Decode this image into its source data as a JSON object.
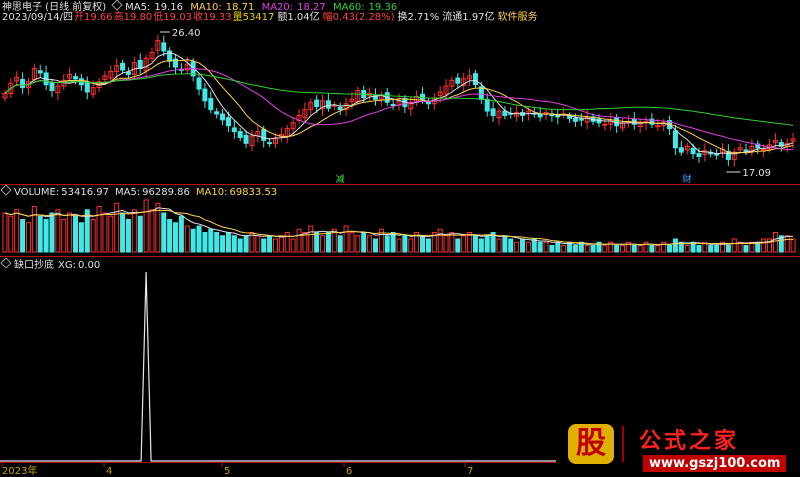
{
  "stock": {
    "title": "神思电子 (日线 前复权)",
    "date": "2023/09/14/四",
    "open_label": "开",
    "open": "19.66",
    "high_label": "高",
    "high": "19.80",
    "low_label": "低",
    "low": "19.03",
    "close_label": "收",
    "close": "19.33",
    "vol_label": "量",
    "volume": "53417",
    "amt_label": "额",
    "amount": "1.04亿",
    "chg_label": "幅",
    "change": "0.43(2.28%)",
    "turn_label": "换",
    "turnover": "2.71%",
    "float_label": "流通",
    "float_cap": "1.97亿",
    "sector": "软件服务"
  },
  "ma": [
    {
      "label": "MA5:",
      "value": "19.16",
      "color": "#e0e0e0"
    },
    {
      "label": "MA10:",
      "value": "18.71",
      "color": "#ffd24a"
    },
    {
      "label": "MA20:",
      "value": "18.27",
      "color": "#e040e0"
    },
    {
      "label": "MA60:",
      "value": "19.36",
      "color": "#30d030"
    }
  ],
  "vol_panel": {
    "label": "VOLUME:",
    "value": "53416.97",
    "ma5_label": "MA5:",
    "ma5": "96289.86",
    "ma10_label": "MA10:",
    "ma10": "69833.53"
  },
  "ind_panel": {
    "label": "缺口抄底",
    "xg_label": "XG:",
    "xg": "0.00"
  },
  "annotations": {
    "max_price": "26.40",
    "min_price": "17.09",
    "mark1": "减",
    "mark2": "财"
  },
  "xaxis": {
    "year": "2023年",
    "m4": "4",
    "m5": "5",
    "m6": "6",
    "m7": "7"
  },
  "colors": {
    "up": "#ff3030",
    "down": "#40e8e8",
    "axis": "#b01010"
  },
  "watermark": {
    "glyph": "股",
    "name": "公式之家",
    "url": "www.gszj100.com"
  },
  "chart_data": {
    "type": "candlestick",
    "price_range": [
      16.5,
      27.0
    ],
    "closes": [
      22.4,
      23.1,
      23.5,
      22.8,
      23.2,
      24.1,
      23.8,
      23.0,
      22.6,
      22.9,
      23.3,
      23.7,
      23.4,
      23.0,
      22.5,
      22.8,
      23.2,
      23.6,
      23.9,
      24.3,
      24.0,
      23.7,
      24.5,
      24.1,
      24.8,
      25.2,
      26.0,
      25.3,
      24.6,
      24.2,
      24.0,
      24.4,
      23.6,
      22.7,
      21.9,
      21.3,
      21.0,
      20.6,
      20.2,
      19.8,
      19.4,
      19.0,
      19.5,
      19.8,
      19.2,
      19.0,
      19.3,
      19.6,
      20.0,
      20.4,
      20.9,
      21.3,
      21.8,
      21.5,
      21.9,
      21.4,
      21.6,
      21.3,
      21.7,
      22.0,
      22.6,
      22.1,
      22.4,
      22.0,
      22.3,
      21.8,
      21.6,
      21.9,
      21.5,
      21.8,
      22.2,
      22.0,
      21.7,
      22.1,
      22.5,
      22.9,
      23.3,
      23.1,
      23.4,
      23.6,
      23.0,
      22.0,
      21.2,
      20.9,
      21.2,
      20.9,
      21.0,
      21.1,
      20.9,
      21.2,
      21.0,
      20.8,
      21.1,
      20.9,
      20.8,
      21.0,
      20.7,
      20.5,
      20.6,
      20.8,
      20.5,
      20.4,
      20.3,
      20.6,
      20.2,
      20.4,
      20.5,
      20.3,
      20.4,
      20.5,
      20.3,
      20.2,
      20.4,
      20.0,
      18.7,
      18.4,
      18.8,
      18.3,
      18.1,
      18.5,
      18.3,
      18.2,
      18.6,
      17.9,
      18.4,
      18.7,
      18.5,
      18.8,
      18.7,
      18.6,
      18.9,
      19.2,
      18.8,
      19.0,
      19.3
    ],
    "volumes": [
      1.2,
      1.1,
      1.3,
      1.0,
      0.9,
      1.4,
      1.1,
      1.0,
      1.2,
      1.3,
      1.0,
      1.2,
      1.1,
      0.9,
      1.3,
      1.0,
      1.4,
      1.2,
      1.1,
      1.5,
      1.2,
      1.0,
      1.3,
      1.1,
      1.6,
      1.3,
      1.5,
      1.2,
      1.0,
      0.9,
      1.1,
      0.8,
      0.7,
      0.8,
      0.6,
      0.7,
      0.6,
      0.5,
      0.6,
      0.5,
      0.4,
      0.5,
      0.6,
      0.5,
      0.4,
      0.5,
      0.4,
      0.5,
      0.6,
      0.4,
      0.7,
      0.6,
      0.8,
      0.6,
      0.5,
      0.6,
      0.7,
      0.5,
      0.8,
      0.6,
      0.5,
      0.6,
      0.5,
      0.4,
      0.7,
      0.5,
      0.6,
      0.4,
      0.5,
      0.4,
      0.6,
      0.5,
      0.4,
      0.6,
      0.7,
      0.5,
      0.6,
      0.4,
      0.5,
      0.6,
      0.5,
      0.4,
      0.5,
      0.6,
      0.4,
      0.5,
      0.4,
      0.3,
      0.4,
      0.3,
      0.4,
      0.3,
      0.3,
      0.2,
      0.3,
      0.2,
      0.3,
      0.2,
      0.3,
      0.2,
      0.2,
      0.3,
      0.2,
      0.3,
      0.2,
      0.2,
      0.3,
      0.2,
      0.2,
      0.3,
      0.2,
      0.2,
      0.3,
      0.2,
      0.4,
      0.3,
      0.2,
      0.3,
      0.2,
      0.3,
      0.2,
      0.2,
      0.3,
      0.2,
      0.4,
      0.3,
      0.2,
      0.3,
      0.3,
      0.4,
      0.4,
      0.6,
      0.5,
      0.5,
      0.4
    ],
    "signal": {
      "x_index": 24,
      "value": 1
    }
  }
}
